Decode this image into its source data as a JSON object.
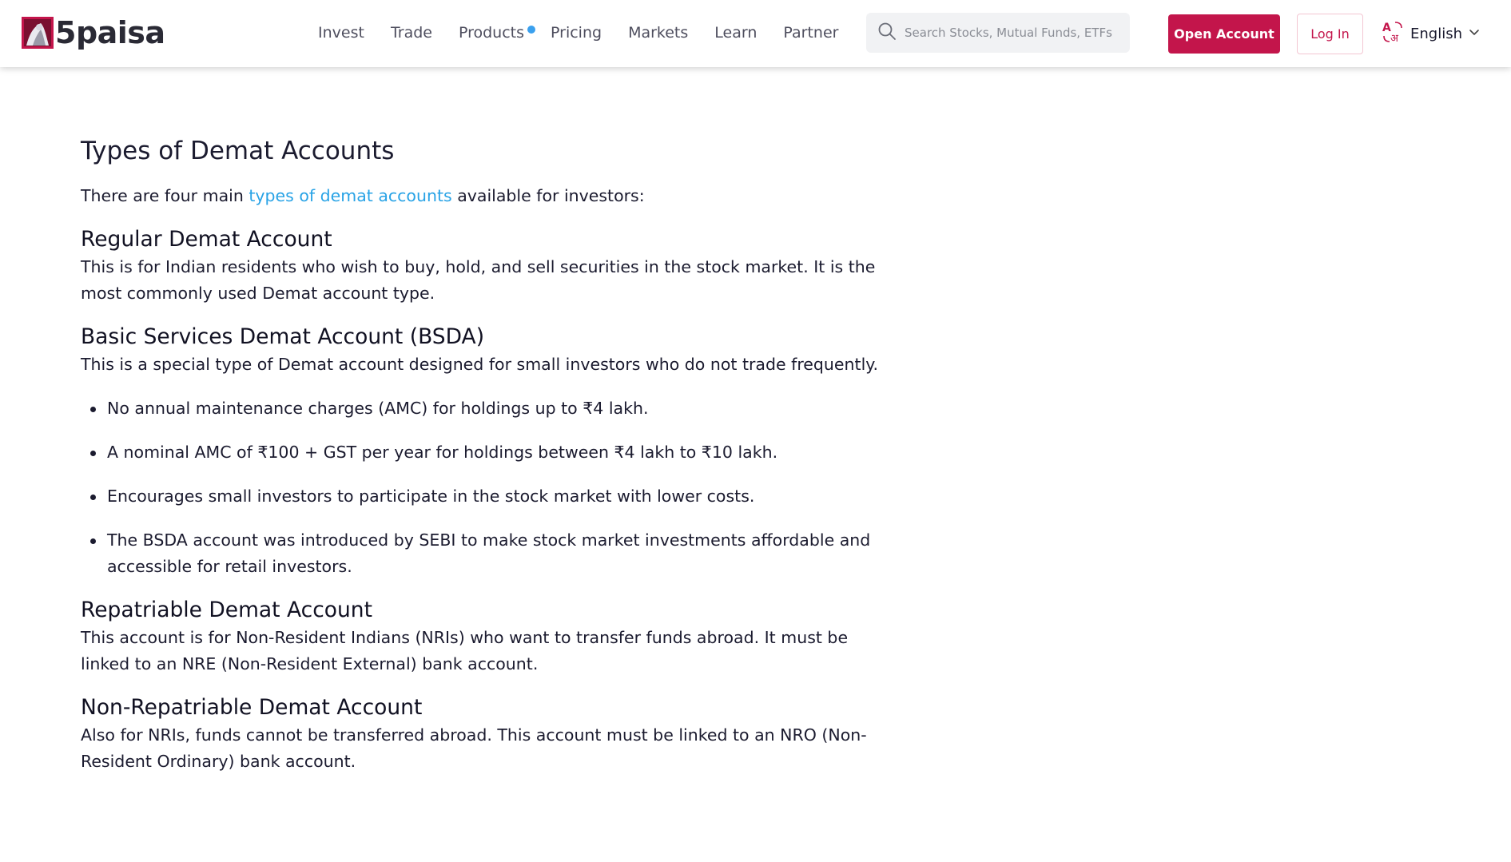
{
  "header": {
    "logo_text": "5paisa",
    "nav": [
      {
        "label": "Invest",
        "has_dot": false
      },
      {
        "label": "Trade",
        "has_dot": false
      },
      {
        "label": "Products",
        "has_dot": true
      },
      {
        "label": "Pricing",
        "has_dot": false
      },
      {
        "label": "Markets",
        "has_dot": false
      },
      {
        "label": "Learn",
        "has_dot": false
      },
      {
        "label": "Partner",
        "has_dot": false
      }
    ],
    "search_placeholder": "Search Stocks, Mutual Funds, ETFs",
    "open_account_label": "Open Account",
    "login_label": "Log In",
    "language_label": "English",
    "icons": {
      "search": "search-icon",
      "language": "translate-icon",
      "dropdown": "chevron-down-icon"
    }
  },
  "colors": {
    "brand": "#c3154b",
    "link": "#29a3e6",
    "nav_dot": "#3aa0ee",
    "text": "#1b1b2f"
  },
  "article": {
    "title": "Types of Demat Accounts",
    "intro": {
      "before": "There are four main ",
      "link": "types of demat accounts",
      "after": " available for investors:"
    },
    "sections": [
      {
        "heading": "Regular Demat Account",
        "body": "This is for Indian residents who wish to buy, hold, and sell securities in the stock market. It is the most commonly used Demat account type."
      },
      {
        "heading": "Basic Services Demat Account (BSDA)",
        "body": "This is a special type of Demat account designed for small investors who do not trade frequently.",
        "bullets": [
          "No annual maintenance charges (AMC) for holdings up to ₹4 lakh.",
          "A nominal AMC of ₹100 + GST per year for holdings between ₹4 lakh to ₹10 lakh.",
          "Encourages small investors to participate in the stock market with lower costs.",
          "The BSDA account was introduced by SEBI to make stock market investments affordable and accessible for retail investors."
        ]
      },
      {
        "heading": "Repatriable Demat Account",
        "body": "This account is for Non-Resident Indians (NRIs) who want to transfer funds abroad. It must be linked to an NRE (Non-Resident External) bank account."
      },
      {
        "heading": "Non-Repatriable Demat Account",
        "body": "Also for NRIs, funds cannot be transferred abroad. This account must be linked to an NRO (Non-Resident Ordinary) bank account."
      }
    ]
  }
}
